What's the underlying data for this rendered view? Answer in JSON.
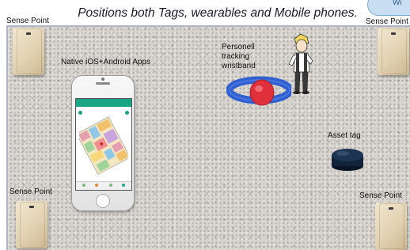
{
  "title": "Positions both Tags, wearables and Mobile phones.",
  "sense_point_label": "Sense Point",
  "corner_badge_text": "Wi",
  "phone_label": "Native iOS+Android Apps",
  "wristband_label_lines": [
    "Personell",
    "tracking",
    "wristband"
  ],
  "asset_tag_label": "Asset tag",
  "colors": {
    "title_text": "#1a1a2a",
    "floor": "#d8d4cf",
    "sense_point_device": "#e6d8bb",
    "app_header": "#1aa585",
    "wristband_strap": "#2f5fd0",
    "wristband_tag": "#e0303a",
    "asset_tag": "#12243a"
  },
  "icons": {
    "sense_point": "sense-point-device-icon",
    "phone": "smartphone-icon",
    "wristband": "wristband-icon",
    "person": "person-cartoon-icon",
    "asset_tag": "asset-tag-puck-icon"
  }
}
